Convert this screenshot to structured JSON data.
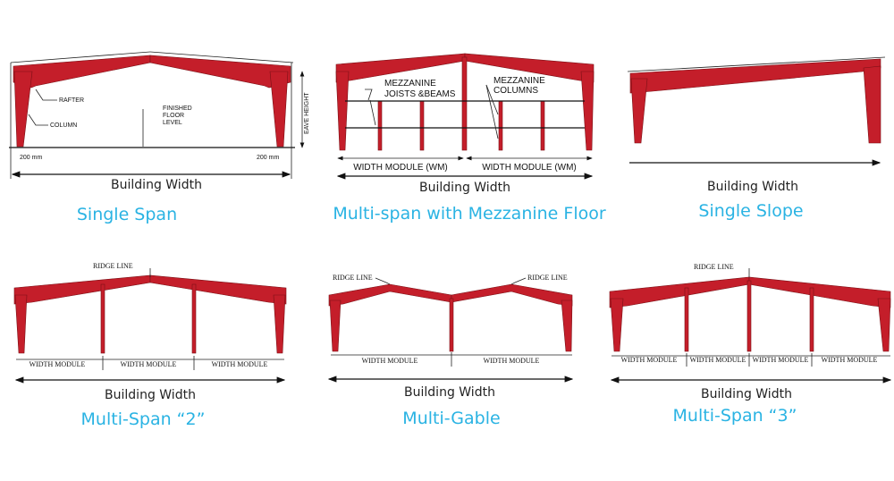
{
  "colors": {
    "frame": "#c41e2a",
    "title": "#2ab3e3"
  },
  "panels": [
    {
      "title": "Single Span",
      "building_width": "Building Width",
      "labels": {
        "rafter": "RAFTER",
        "column": "COLUMN",
        "ffl1": "FINISHED",
        "ffl2": "FLOOR",
        "ffl3": "LEVEL",
        "eave": "EAVE HEIGHT",
        "dim_left": "200 mm",
        "dim_right": "200 mm"
      }
    },
    {
      "title": "Multi-span with Mezzanine Floor",
      "building_width": "Building Width",
      "labels": {
        "mj1": "MEZZANINE",
        "mj2": "JOISTS &BEAMS",
        "mc1": "MEZZANINE",
        "mc2": "COLUMNS",
        "wm1": "WIDTH MODULE (WM)",
        "wm2": "WIDTH MODULE (WM)"
      }
    },
    {
      "title": "Single Slope",
      "building_width": "Building Width"
    },
    {
      "title": "Multi-Span “2”",
      "building_width": "Building Width",
      "labels": {
        "ridge": "RIDGE LINE",
        "wm": [
          "WIDTH MODULE",
          "WIDTH MODULE",
          "WIDTH MODULE"
        ]
      }
    },
    {
      "title": "Multi-Gable",
      "building_width": "Building Width",
      "labels": {
        "ridge1": "RIDGE LINE",
        "ridge2": "RIDGE LINE",
        "wm": [
          "WIDTH MODULE",
          "WIDTH MODULE"
        ]
      }
    },
    {
      "title": "Multi-Span “3”",
      "building_width": "Building Width",
      "labels": {
        "ridge": "RIDGE LINE",
        "wm": [
          "WIDTH MODULE",
          "WIDTH MODULE",
          "WIDTH MODULE",
          "WIDTH MODULE"
        ]
      }
    }
  ]
}
